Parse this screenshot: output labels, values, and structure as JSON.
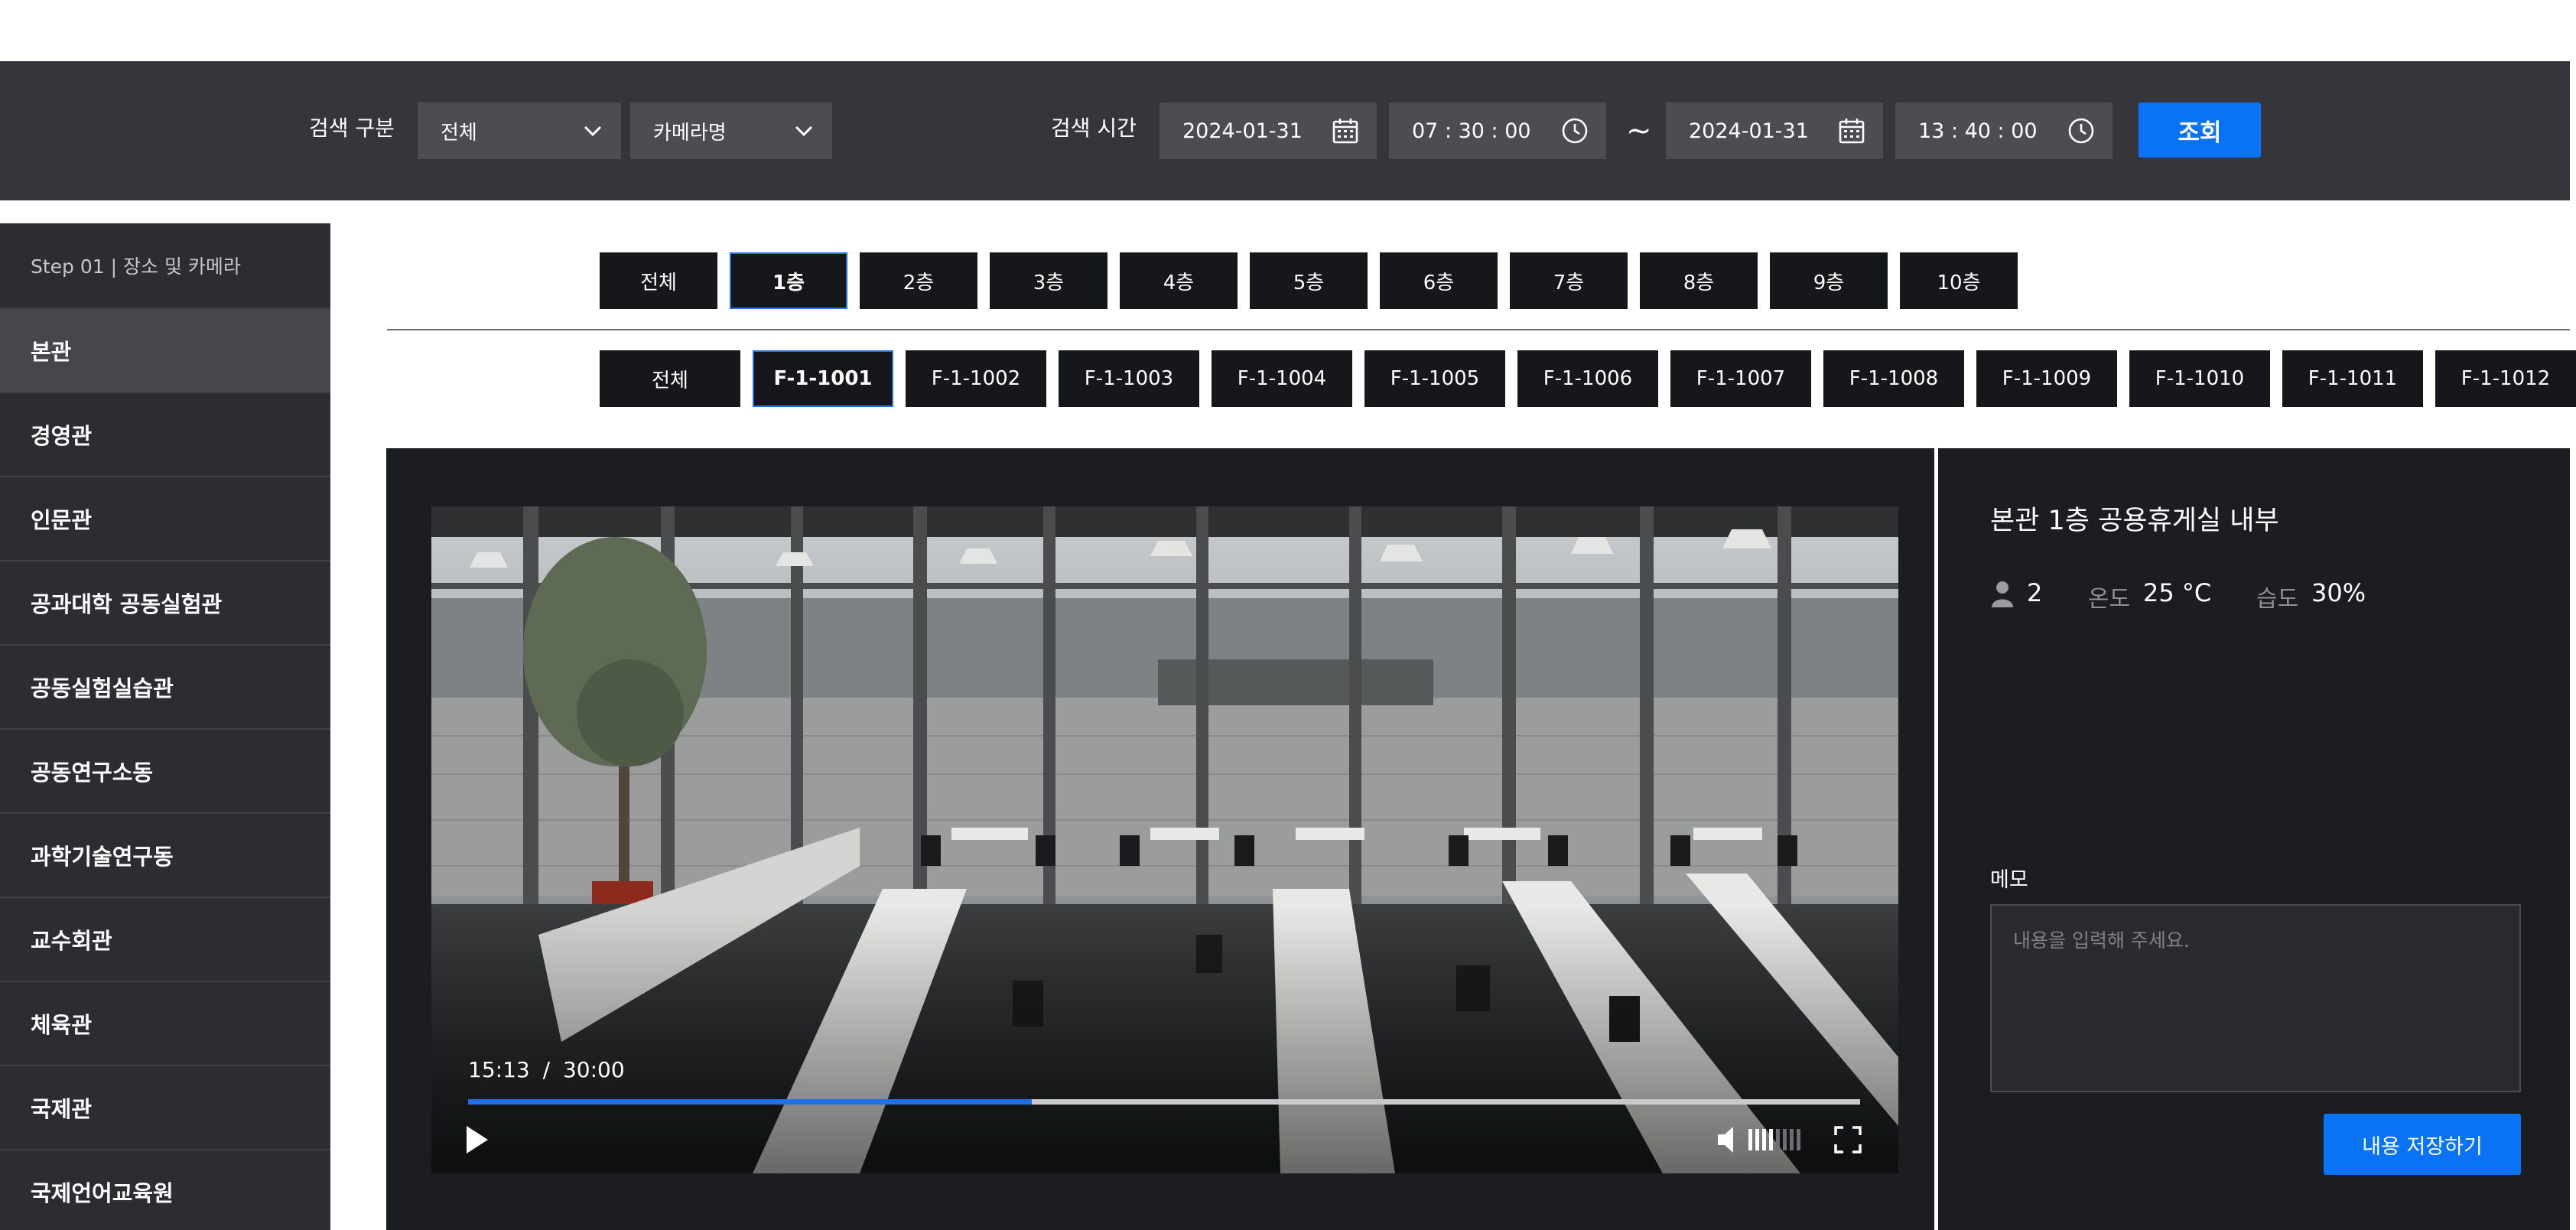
{
  "search": {
    "category_label": "검색 구분",
    "category_select": "전체",
    "camera_select": "카메라명",
    "time_label": "검색 시간",
    "start_date": "2024-01-31",
    "start_time": "07 : 30 : 00",
    "range_sep": "~",
    "end_date": "2024-01-31",
    "end_time": "13 : 40 : 00",
    "query_button": "조회"
  },
  "sidebar": {
    "step_label": "Step 01  |  장소 및 카메라",
    "items": [
      {
        "label": "본관",
        "active": true
      },
      {
        "label": "경영관"
      },
      {
        "label": "인문관"
      },
      {
        "label": "공과대학 공동실험관"
      },
      {
        "label": "공동실험실습관"
      },
      {
        "label": "공동연구소동"
      },
      {
        "label": "과학기술연구동"
      },
      {
        "label": "교수회관"
      },
      {
        "label": "체육관"
      },
      {
        "label": "국제관"
      },
      {
        "label": "국제언어교육원"
      }
    ]
  },
  "floors": [
    "전체",
    "1층",
    "2층",
    "3층",
    "4층",
    "5층",
    "6층",
    "7층",
    "8층",
    "9층",
    "10층"
  ],
  "floors_active": "1층",
  "cameras": [
    "전체",
    "F-1-1001",
    "F-1-1002",
    "F-1-1003",
    "F-1-1004",
    "F-1-1005",
    "F-1-1006",
    "F-1-1007",
    "F-1-1008",
    "F-1-1009",
    "F-1-1010",
    "F-1-1011",
    "F-1-1012"
  ],
  "cameras_active": "F-1-1001",
  "player": {
    "current_time": "15:13",
    "sep": "/",
    "duration": "30:00",
    "progress": 0.405,
    "volume_level": 0.5
  },
  "info": {
    "title": "본관 1층 공용휴게실 내부",
    "people_count": "2",
    "temp_label": "온도",
    "temp_value": "25 °C",
    "humidity_label": "습도",
    "humidity_value": "30%"
  },
  "memo": {
    "label": "메모",
    "placeholder": "내용을 입력해 주세요.",
    "save_button": "내용 저장하기"
  },
  "colors": {
    "accent": "#0a73f5",
    "bar_bg": "#34363c",
    "sidebar_bg": "#2b2d32",
    "panel_bg": "#1c1d21"
  }
}
